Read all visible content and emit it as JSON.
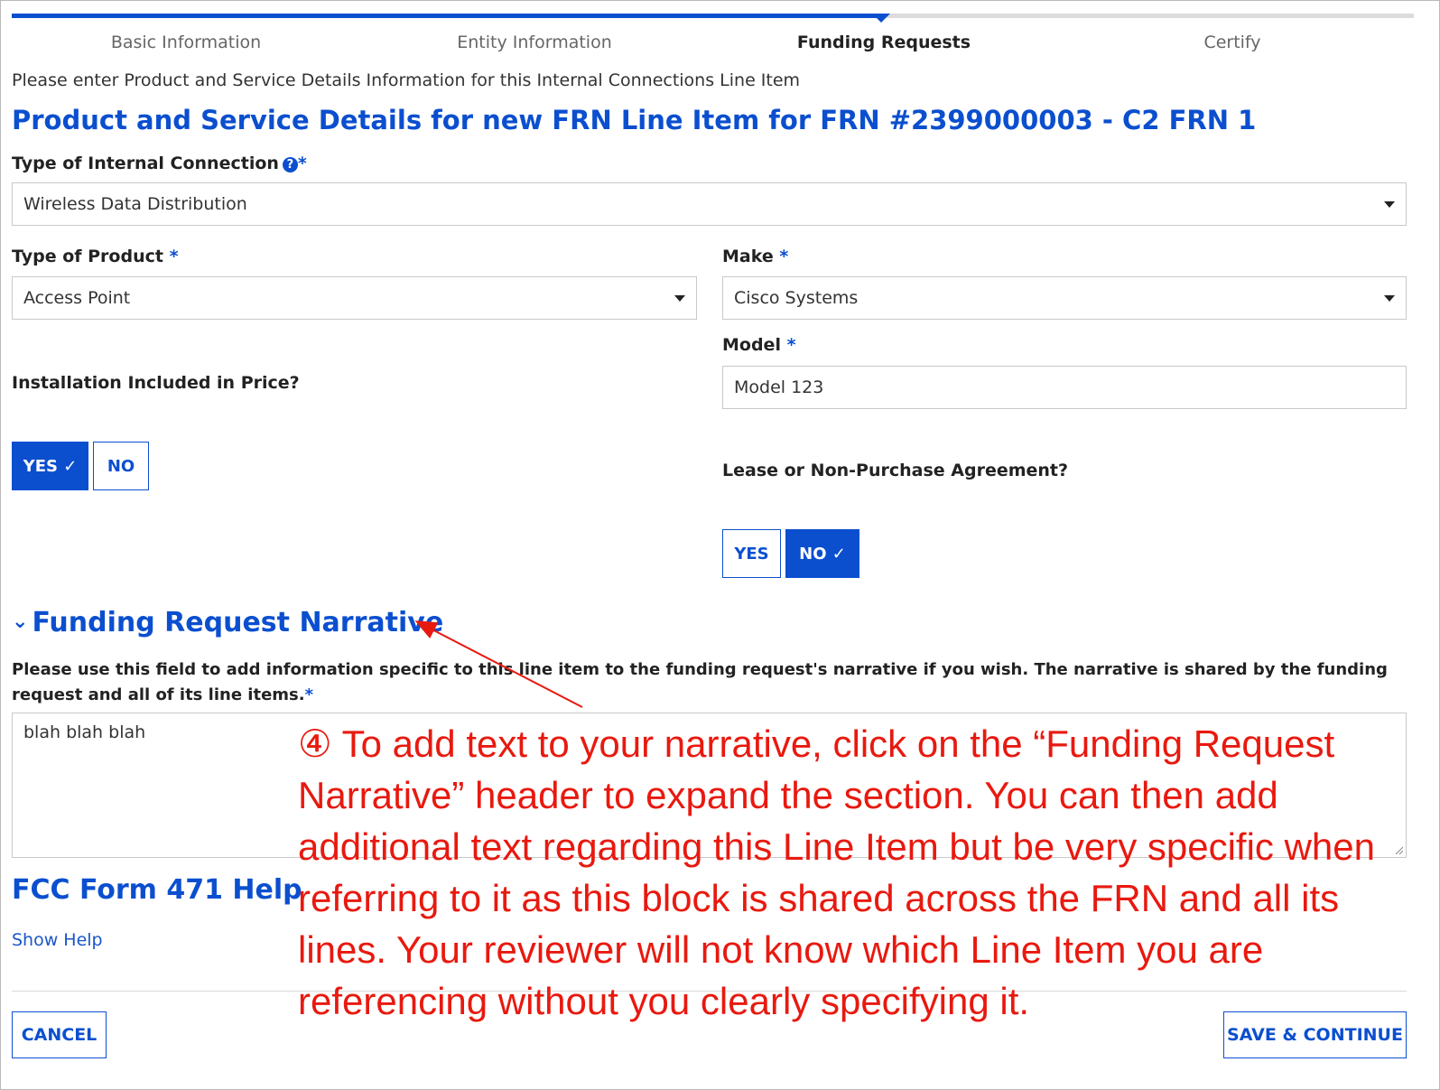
{
  "steps": [
    {
      "label": "Basic Information"
    },
    {
      "label": "Entity Information"
    },
    {
      "label": "Funding Requests"
    },
    {
      "label": "Certify"
    }
  ],
  "progress": {
    "current_step": 3,
    "fraction": 0.62
  },
  "intro": "Please enter Product and Service Details Information for this Internal Connections Line Item",
  "title": "Product and Service Details for new FRN Line Item for FRN #2399000003 - C2 FRN 1",
  "fields": {
    "internal_connection": {
      "label": "Type of Internal Connection",
      "value": "Wireless Data Distribution"
    },
    "product": {
      "label": "Type of Product",
      "value": "Access Point"
    },
    "make": {
      "label": "Make",
      "value": "Cisco Systems"
    },
    "model": {
      "label": "Model",
      "value": "Model 123"
    },
    "installation": {
      "label": "Installation Included in Price?",
      "yes": "YES ✓",
      "no": "NO",
      "selected": "yes"
    },
    "lease": {
      "label": "Lease or Non-Purchase Agreement?",
      "yes": "YES",
      "no": "NO ✓",
      "selected": "no"
    }
  },
  "required_mark": "*",
  "narrative": {
    "header": "Funding Request Narrative",
    "description": "Please use this field to add information specific to this line item to the funding request's narrative if you wish. The narrative is shared by the funding request and all of its line items.",
    "value": "blah blah blah"
  },
  "help": {
    "title": "FCC Form 471 Help",
    "link": "Show Help"
  },
  "buttons": {
    "cancel": "CANCEL",
    "save": "SAVE & CONTINUE"
  },
  "annotation": "④ To add text to your narrative, click on the “Funding Request Narrative” header to expand the section. You can then add additional text regarding this Line Item but be very specific when referring to it as this block is shared across the FRN and all its lines. Your reviewer will not know which Line Item you are referencing without you clearly specifying it.",
  "colors": {
    "accent": "#0b4fcf",
    "annotation": "#e8190f"
  }
}
